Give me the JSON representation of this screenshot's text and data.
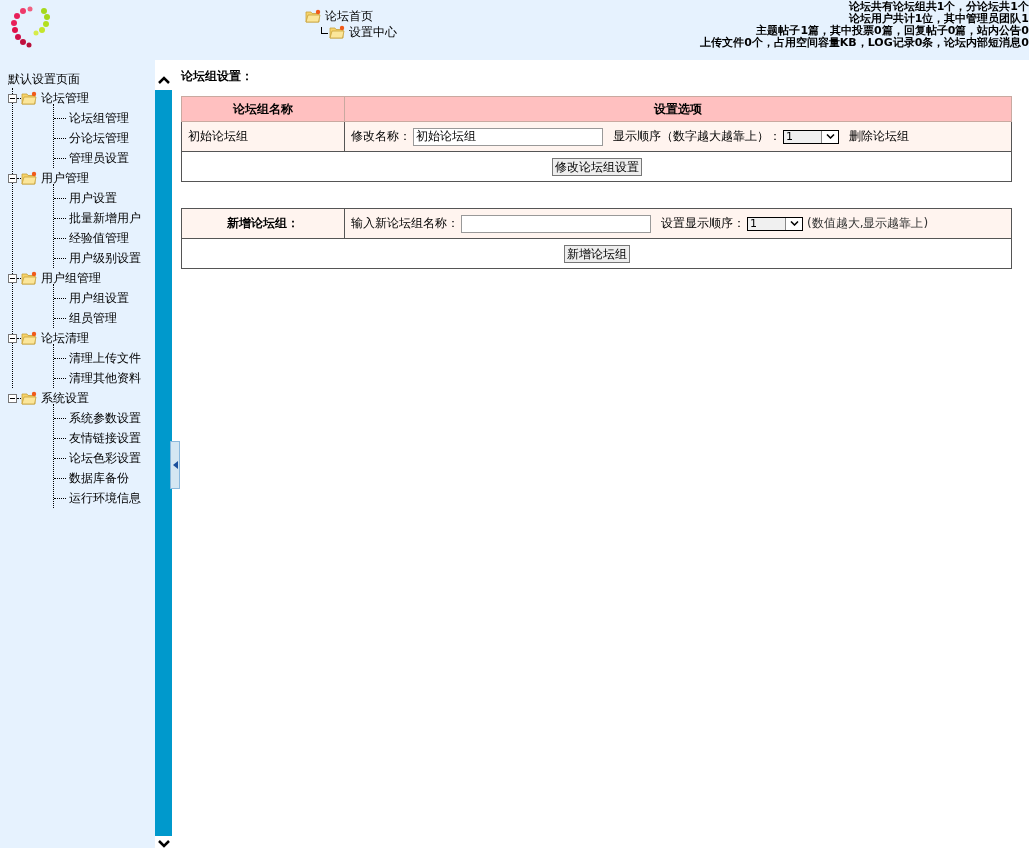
{
  "header": {
    "nav": [
      {
        "label": "论坛首页",
        "children": [
          {
            "label": "设置中心"
          }
        ]
      }
    ],
    "stats": [
      "论坛共有论坛组共1个，分论坛共1个",
      "论坛用户共计1位，其中管理员团队1",
      "主题帖子1篇，其中投票0篇，回复帖子0篇，站内公告0",
      "上传文件0个，占用空间容量KB，LOG记录0条，论坛内部短消息0"
    ]
  },
  "sidebar": {
    "title": "默认设置页面",
    "items": [
      {
        "label": "论坛管理",
        "expanded": true,
        "children": [
          {
            "label": "论坛组管理"
          },
          {
            "label": "分论坛管理"
          },
          {
            "label": "管理员设置"
          }
        ]
      },
      {
        "label": "用户管理",
        "expanded": true,
        "children": [
          {
            "label": "用户设置"
          },
          {
            "label": "批量新增用户"
          },
          {
            "label": "经验值管理"
          },
          {
            "label": "用户级别设置"
          }
        ]
      },
      {
        "label": "用户组管理",
        "expanded": true,
        "children": [
          {
            "label": "用户组设置"
          },
          {
            "label": "组员管理"
          }
        ]
      },
      {
        "label": "论坛清理",
        "expanded": true,
        "children": [
          {
            "label": "清理上传文件"
          },
          {
            "label": "清理其他资料"
          }
        ]
      },
      {
        "label": "系统设置",
        "expanded": true,
        "children": [
          {
            "label": "系统参数设置"
          },
          {
            "label": "友情链接设置"
          },
          {
            "label": "论坛色彩设置"
          },
          {
            "label": "数据库备份"
          },
          {
            "label": "运行环境信息"
          }
        ]
      }
    ]
  },
  "main": {
    "title": "论坛组设置：",
    "groups_table": {
      "columns": [
        "论坛组名称",
        "设置选项"
      ],
      "rows": [
        {
          "name": "初始论坛组",
          "rename_label": "修改名称：",
          "rename_value": "初始论坛组",
          "order_label": "显示顺序（数字越大越靠上）：",
          "order_value": "1",
          "delete_link": "删除论坛组"
        }
      ],
      "submit": "修改论坛组设置"
    },
    "new_group": {
      "heading": "新增论坛组：",
      "name_label": "输入新论坛组名称：",
      "order_label": "设置显示顺序：",
      "order_value": "1",
      "hint": "(数值越大,显示越靠上)",
      "submit": "新增论坛组"
    }
  }
}
